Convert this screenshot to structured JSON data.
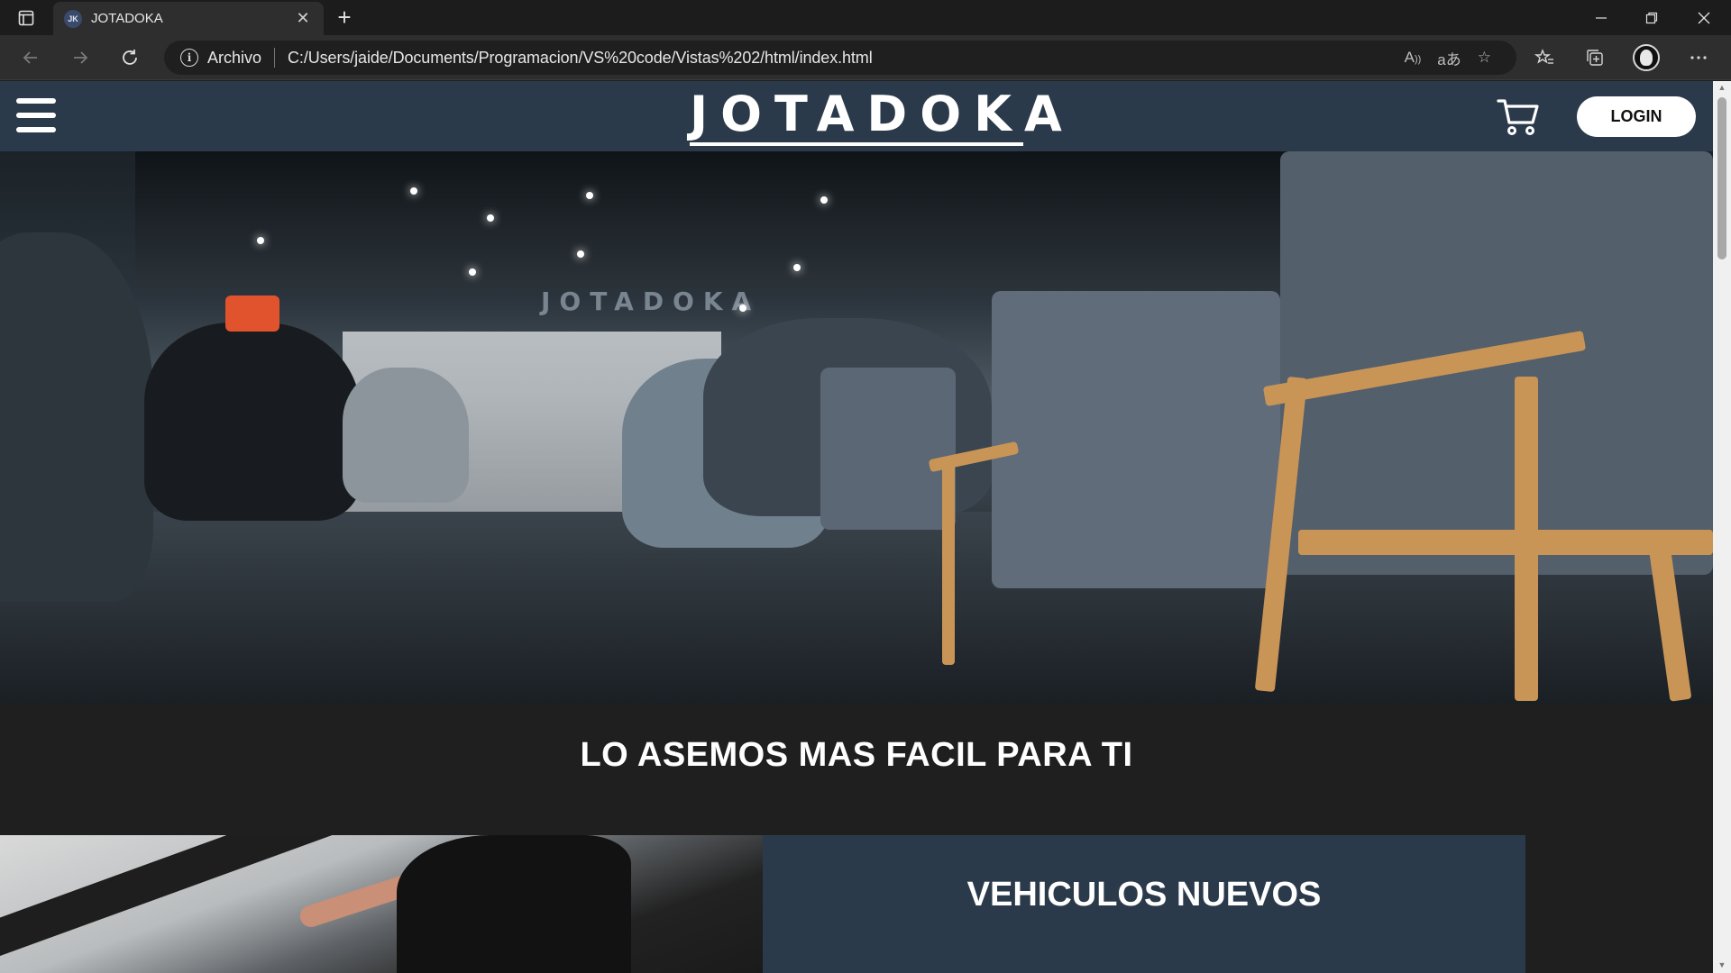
{
  "browser": {
    "tab": {
      "favicon_text": "JK",
      "title": "JOTADOKA"
    },
    "address": {
      "protocol_label": "Archivo",
      "url": "C:/Users/jaide/Documents/Programacion/VS%20code/Vistas%202/html/index.html"
    }
  },
  "site": {
    "brand": "JOTADOKA",
    "login_label": "LOGIN",
    "hero_wall_text": "JOTADOKA",
    "slogan": "LO ASEMOS MAS FACIL PARA TI",
    "featured": {
      "title": "VEHICULOS NUEVOS"
    },
    "colors": {
      "header_bg": "#2b3a4a",
      "page_bg": "#1f1f1f",
      "text": "#ffffff"
    }
  }
}
